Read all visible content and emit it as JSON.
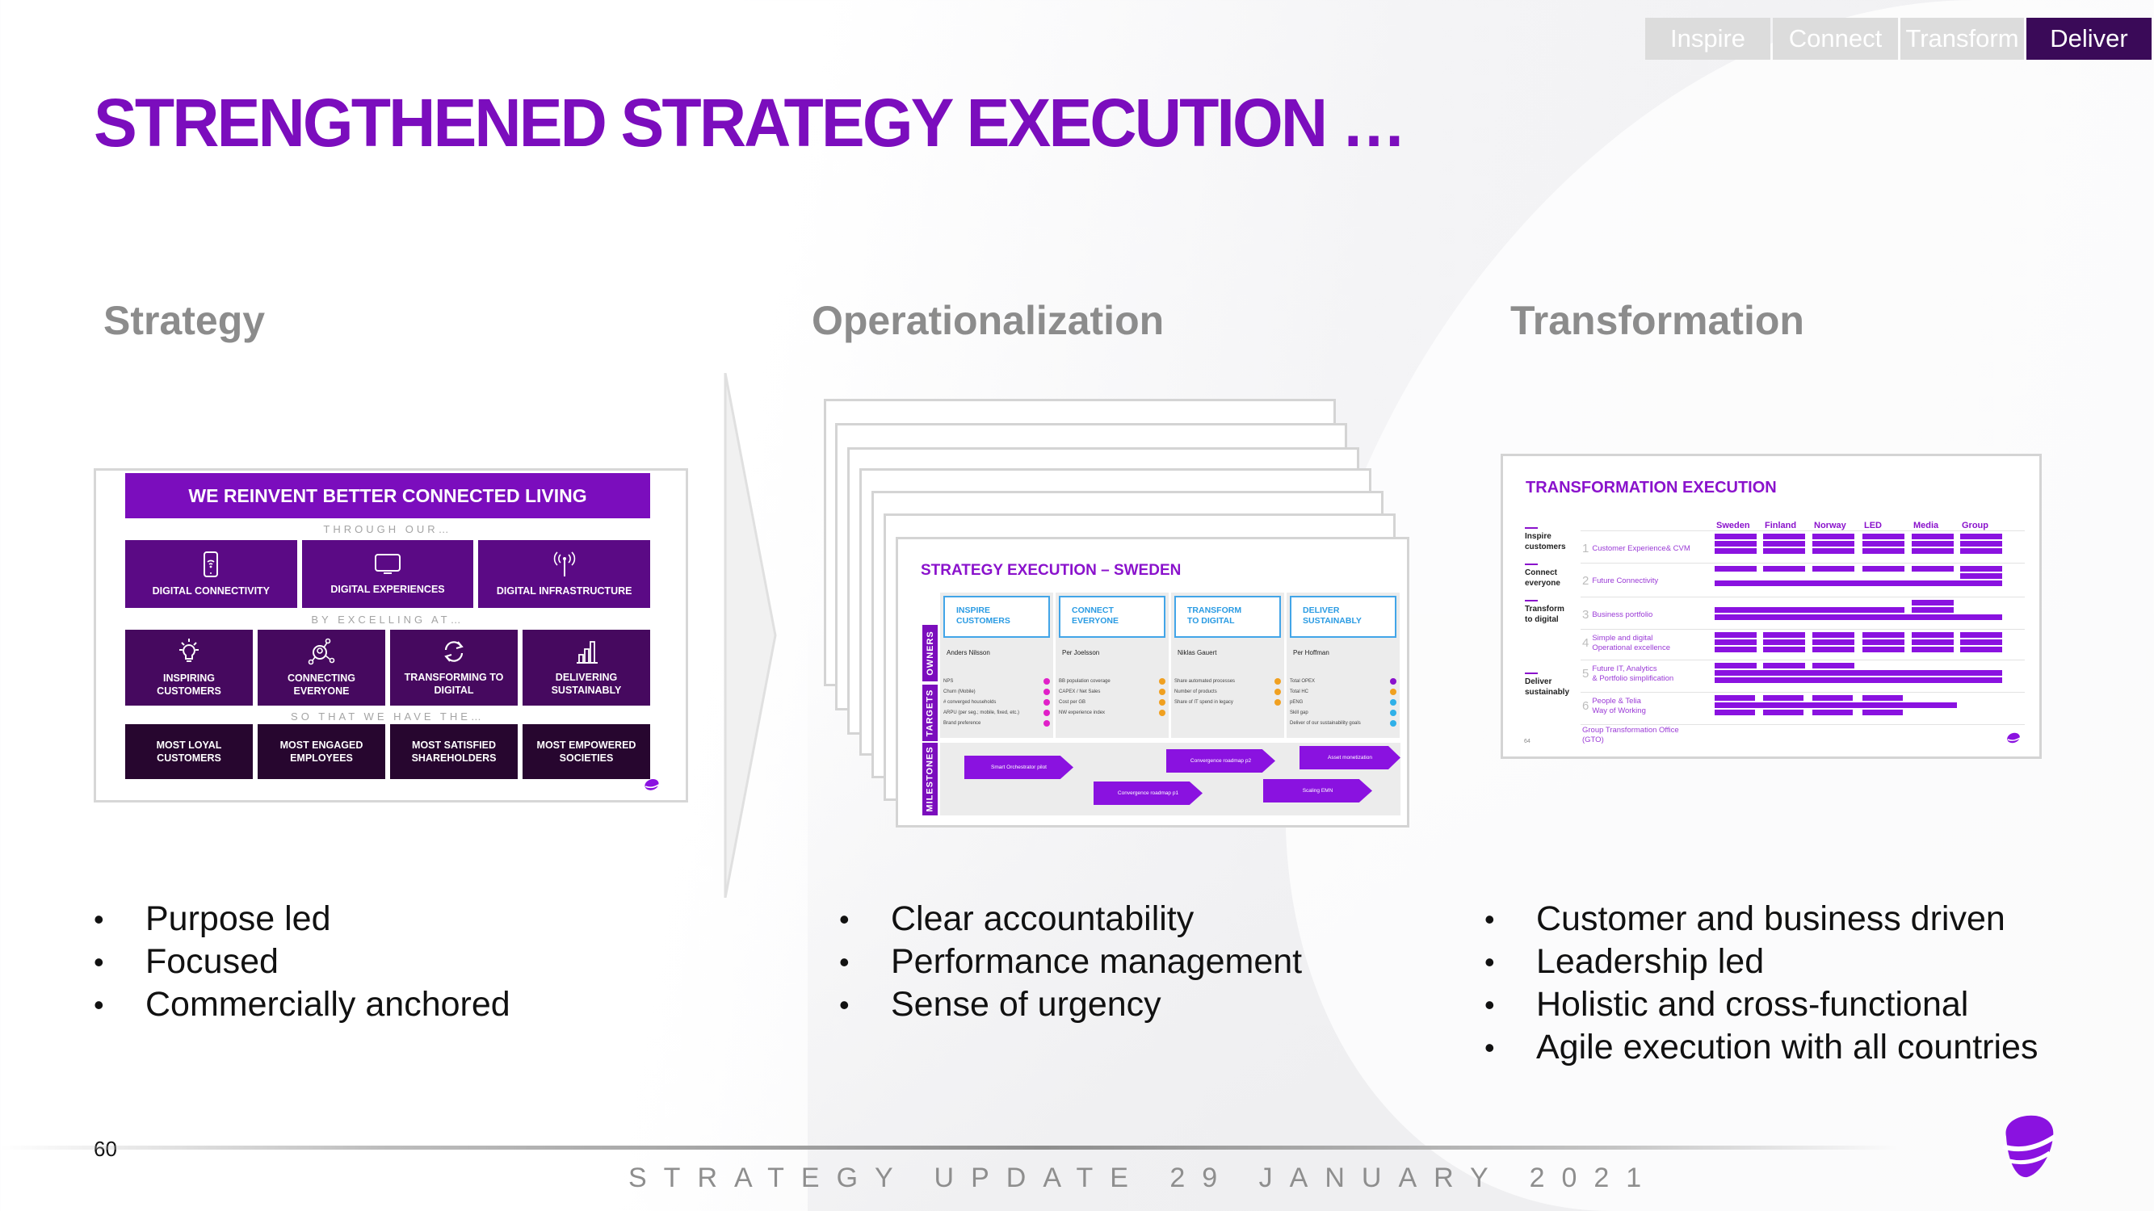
{
  "nav": {
    "tabs": [
      {
        "label": "Inspire",
        "active": false
      },
      {
        "label": "Connect",
        "active": false
      },
      {
        "label": "Transform",
        "active": false
      },
      {
        "label": "Deliver",
        "active": true
      }
    ]
  },
  "title": "STRENGTHENED STRATEGY EXECUTION …",
  "sections": {
    "strategy": {
      "heading": "Strategy",
      "bullets": [
        "Purpose led",
        "Focused",
        "Commercially anchored"
      ]
    },
    "operationalization": {
      "heading": "Operationalization",
      "bullets": [
        "Clear accountability",
        "Performance management",
        "Sense of urgency"
      ]
    },
    "transformation": {
      "heading": "Transformation",
      "bullets": [
        "Customer and business driven",
        "Leadership led",
        "Holistic and cross-functional",
        "Agile execution with all countries"
      ]
    }
  },
  "strategy_slide": {
    "headline": "WE REINVENT BETTER CONNECTED LIVING",
    "sub1": "THROUGH OUR…",
    "sub2": "BY EXCELLING AT…",
    "sub3": "SO THAT WE HAVE THE…",
    "row1": [
      {
        "icon": "smartphone-wifi-icon",
        "label": "DIGITAL CONNECTIVITY"
      },
      {
        "icon": "monitor-icon",
        "label": "DIGITAL EXPERIENCES"
      },
      {
        "icon": "antenna-icon",
        "label": "DIGITAL INFRASTRUCTURE"
      }
    ],
    "row2": [
      {
        "icon": "lightbulb-icon",
        "label1": "INSPIRING",
        "label2": "CUSTOMERS"
      },
      {
        "icon": "network-person-icon",
        "label1": "CONNECTING",
        "label2": "EVERYONE"
      },
      {
        "icon": "refresh-icon",
        "label1": "TRANSFORMING TO",
        "label2": "DIGITAL"
      },
      {
        "icon": "bar-chart-icon",
        "label1": "DELIVERING",
        "label2": "SUSTAINABLY"
      }
    ],
    "row3": [
      {
        "label1": "MOST LOYAL",
        "label2": "CUSTOMERS"
      },
      {
        "label1": "MOST ENGAGED",
        "label2": "EMPLOYEES"
      },
      {
        "label1": "MOST SATISFIED",
        "label2": "SHAREHOLDERS"
      },
      {
        "label1": "MOST EMPOWERED",
        "label2": "SOCIETIES"
      }
    ]
  },
  "op_slide": {
    "title": "STRATEGY EXECUTION – SWEDEN",
    "side_labels": {
      "owners": "OWNERS",
      "targets": "TARGETS",
      "milestones": "MILESTONES"
    },
    "columns": [
      {
        "head1": "INSPIRE",
        "head2": "CUSTOMERS",
        "owner": "Anders Nilsson",
        "targets": [
          "NPS",
          "Churn (Mobile)",
          "# converged households",
          "ARPU (per seg.; mobile, fixed, etc.)",
          "Brand preference"
        ],
        "dot_colors": [
          "#e020c8",
          "#e020c8",
          "#e020c8",
          "#e020c8",
          "#e020c8"
        ]
      },
      {
        "head1": "CONNECT",
        "head2": "EVERYONE",
        "owner": "Per Joelsson",
        "targets": [
          "BB population coverage",
          "CAPEX / Net Sales",
          "Cost per GB",
          "NW experience index"
        ],
        "dot_colors": [
          "#f0a020",
          "#f0a020",
          "#f0a020",
          "#f0a020"
        ]
      },
      {
        "head1": "TRANSFORM",
        "head2": "TO DIGITAL",
        "owner": "Niklas Gauert",
        "targets": [
          "Share automated processes",
          "Number of products",
          "Share of IT spend in legacy"
        ],
        "dot_colors": [
          "#f0a020",
          "#f0a020",
          "#f0a020"
        ]
      },
      {
        "head1": "DELIVER",
        "head2": "SUSTAINABLY",
        "owner": "Per Hoffman",
        "targets": [
          "Total OPEX",
          "Total HC",
          "pENG",
          "Skill gap",
          "Deliver of our sustainability goals"
        ],
        "dot_colors": [
          "#8a12cc",
          "#f0a020",
          "#30b0e8",
          "#30b0e8",
          "#30b0e8"
        ]
      }
    ],
    "milestones": [
      "Smart Orchestrator pilot",
      "Convergence roadmap p1",
      "Convergence roadmap p2",
      "Scaling EMN",
      "Asset monetization"
    ]
  },
  "tr_slide": {
    "title": "TRANSFORMATION EXECUTION",
    "columns": [
      "Sweden",
      "Finland",
      "Norway",
      "LED",
      "Media",
      "Group"
    ],
    "groups": [
      {
        "line1": "Inspire",
        "line2": "customers"
      },
      {
        "line1": "Connect",
        "line2": "everyone"
      },
      {
        "line1": "Transform",
        "line2": "to digital"
      },
      {
        "line1": "Deliver",
        "line2": "sustainably"
      }
    ],
    "items": [
      {
        "num": "1",
        "line1": "Customer Experience& CVM",
        "line2": ""
      },
      {
        "num": "2",
        "line1": "Future Connectivity",
        "line2": ""
      },
      {
        "num": "3",
        "line1": "Business portfolio",
        "line2": ""
      },
      {
        "num": "4",
        "line1": "Simple and digital",
        "line2": "Operational excellence"
      },
      {
        "num": "5",
        "line1": "Future IT, Analytics",
        "line2": "& Portfolio simplification"
      },
      {
        "num": "6",
        "line1": "People & Telia",
        "line2": "Way of Working"
      }
    ],
    "gto_line1": "Group Transformation Office",
    "gto_line2": "(GTO)",
    "page": "64"
  },
  "footer": {
    "page_number": "60",
    "text": "STRATEGY UPDATE 29 JANUARY 2021"
  },
  "colors": {
    "brand_purple": "#7b0dbd",
    "nav_active": "#3a0a58",
    "nav_inactive": "#dcdcdc"
  }
}
